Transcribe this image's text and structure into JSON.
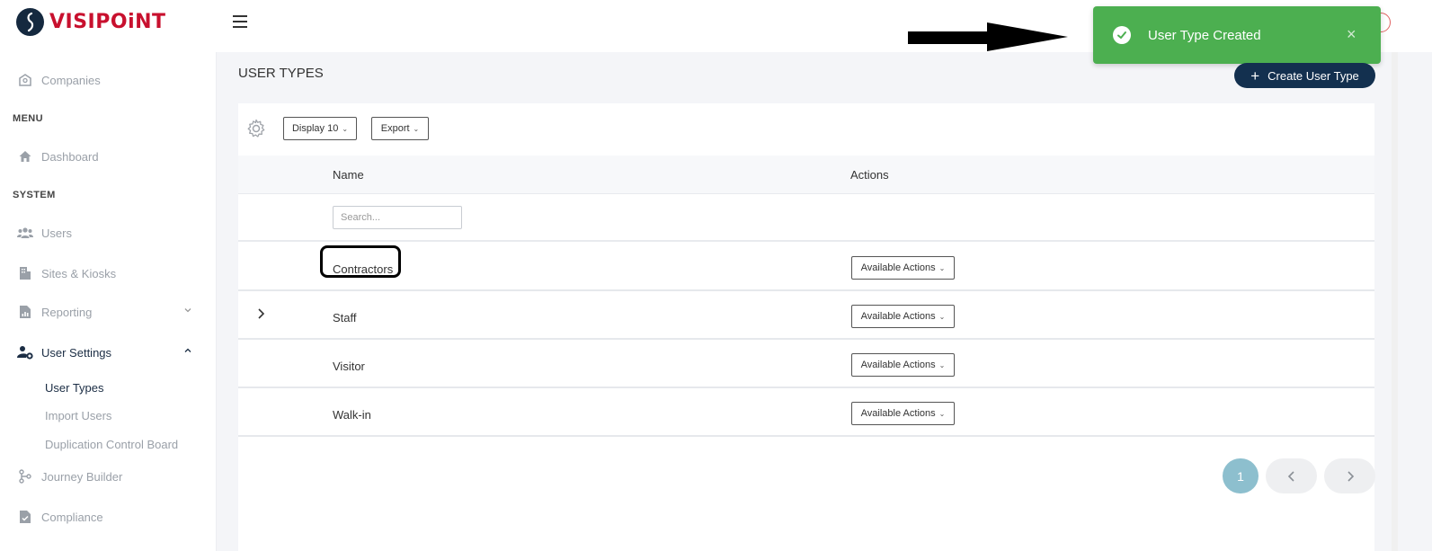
{
  "app": {
    "brand": "VISIPOiNT"
  },
  "toast": {
    "message": "User Type Created",
    "close": "×",
    "color": "#4caf50"
  },
  "sidebar": {
    "companies": "Companies",
    "menu_label": "MENU",
    "dashboard": "Dashboard",
    "system_label": "SYSTEM",
    "users": "Users",
    "sites": "Sites & Kiosks",
    "reporting": "Reporting",
    "user_settings": "User Settings",
    "sub_items": [
      "User Types",
      "Import Users",
      "Duplication Control Board"
    ],
    "journey_builder": "Journey Builder",
    "compliance": "Compliance"
  },
  "main": {
    "title": "USER TYPES",
    "create_label": "Create User Type",
    "display_label": "Display 10",
    "export_label": "Export",
    "columns": {
      "name": "Name",
      "actions": "Actions"
    },
    "search_placeholder": "Search...",
    "rows": [
      {
        "name": "Contractors",
        "actions": "Available Actions"
      },
      {
        "name": "Staff",
        "actions": "Available Actions"
      },
      {
        "name": "Visitor",
        "actions": "Available Actions"
      },
      {
        "name": "Walk-in",
        "actions": "Available Actions"
      }
    ],
    "pagination": {
      "current": "1"
    }
  },
  "colors": {
    "accent": "#13304f",
    "brand": "#c8102e",
    "page_active": "#8dbfce"
  }
}
